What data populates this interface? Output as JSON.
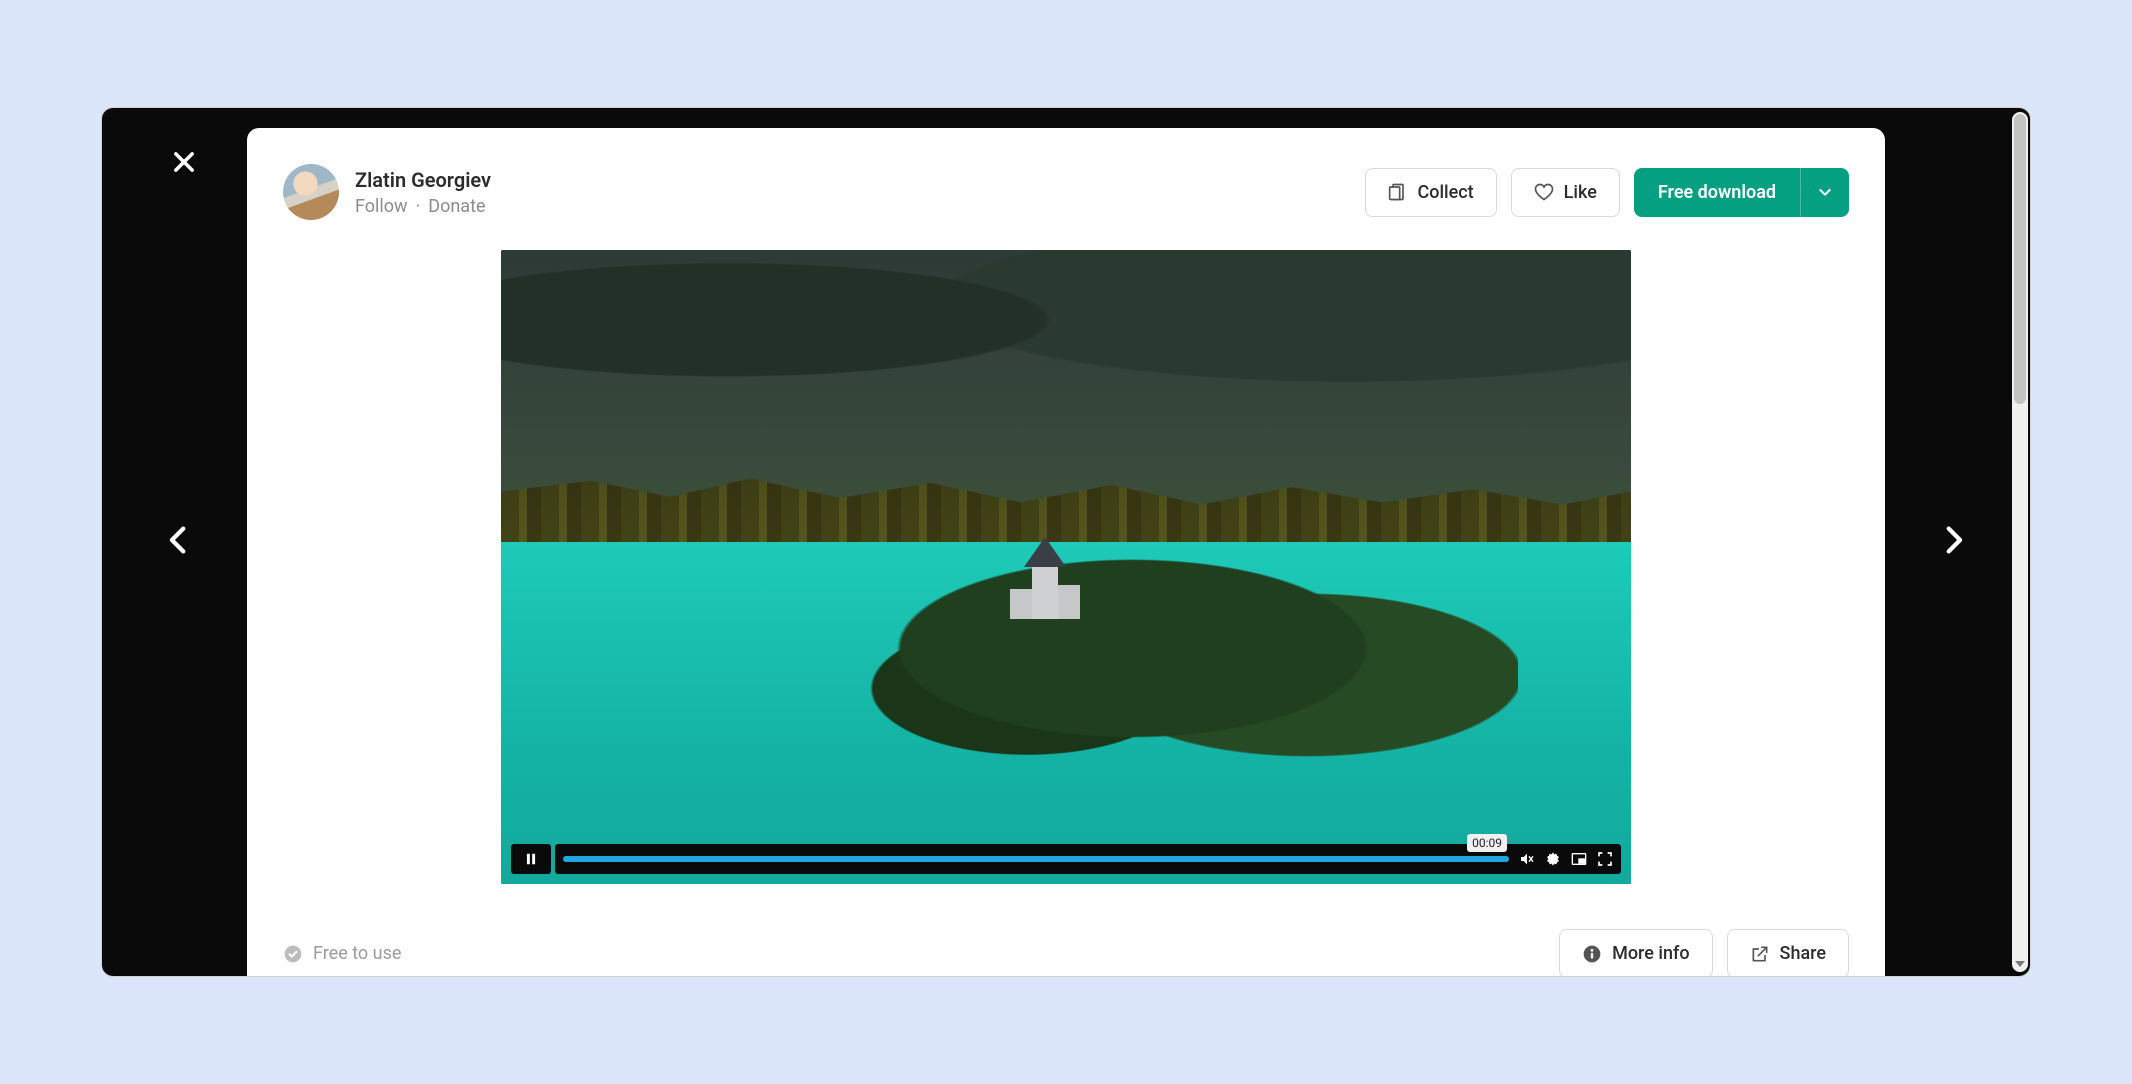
{
  "author": {
    "name": "Zlatin Georgiev",
    "follow_label": "Follow",
    "donate_label": "Donate"
  },
  "actions": {
    "collect_label": "Collect",
    "like_label": "Like",
    "download_label": "Free download"
  },
  "player": {
    "time_tooltip": "00:09"
  },
  "footer": {
    "license_label": "Free to use",
    "more_info_label": "More info",
    "share_label": "Share"
  }
}
